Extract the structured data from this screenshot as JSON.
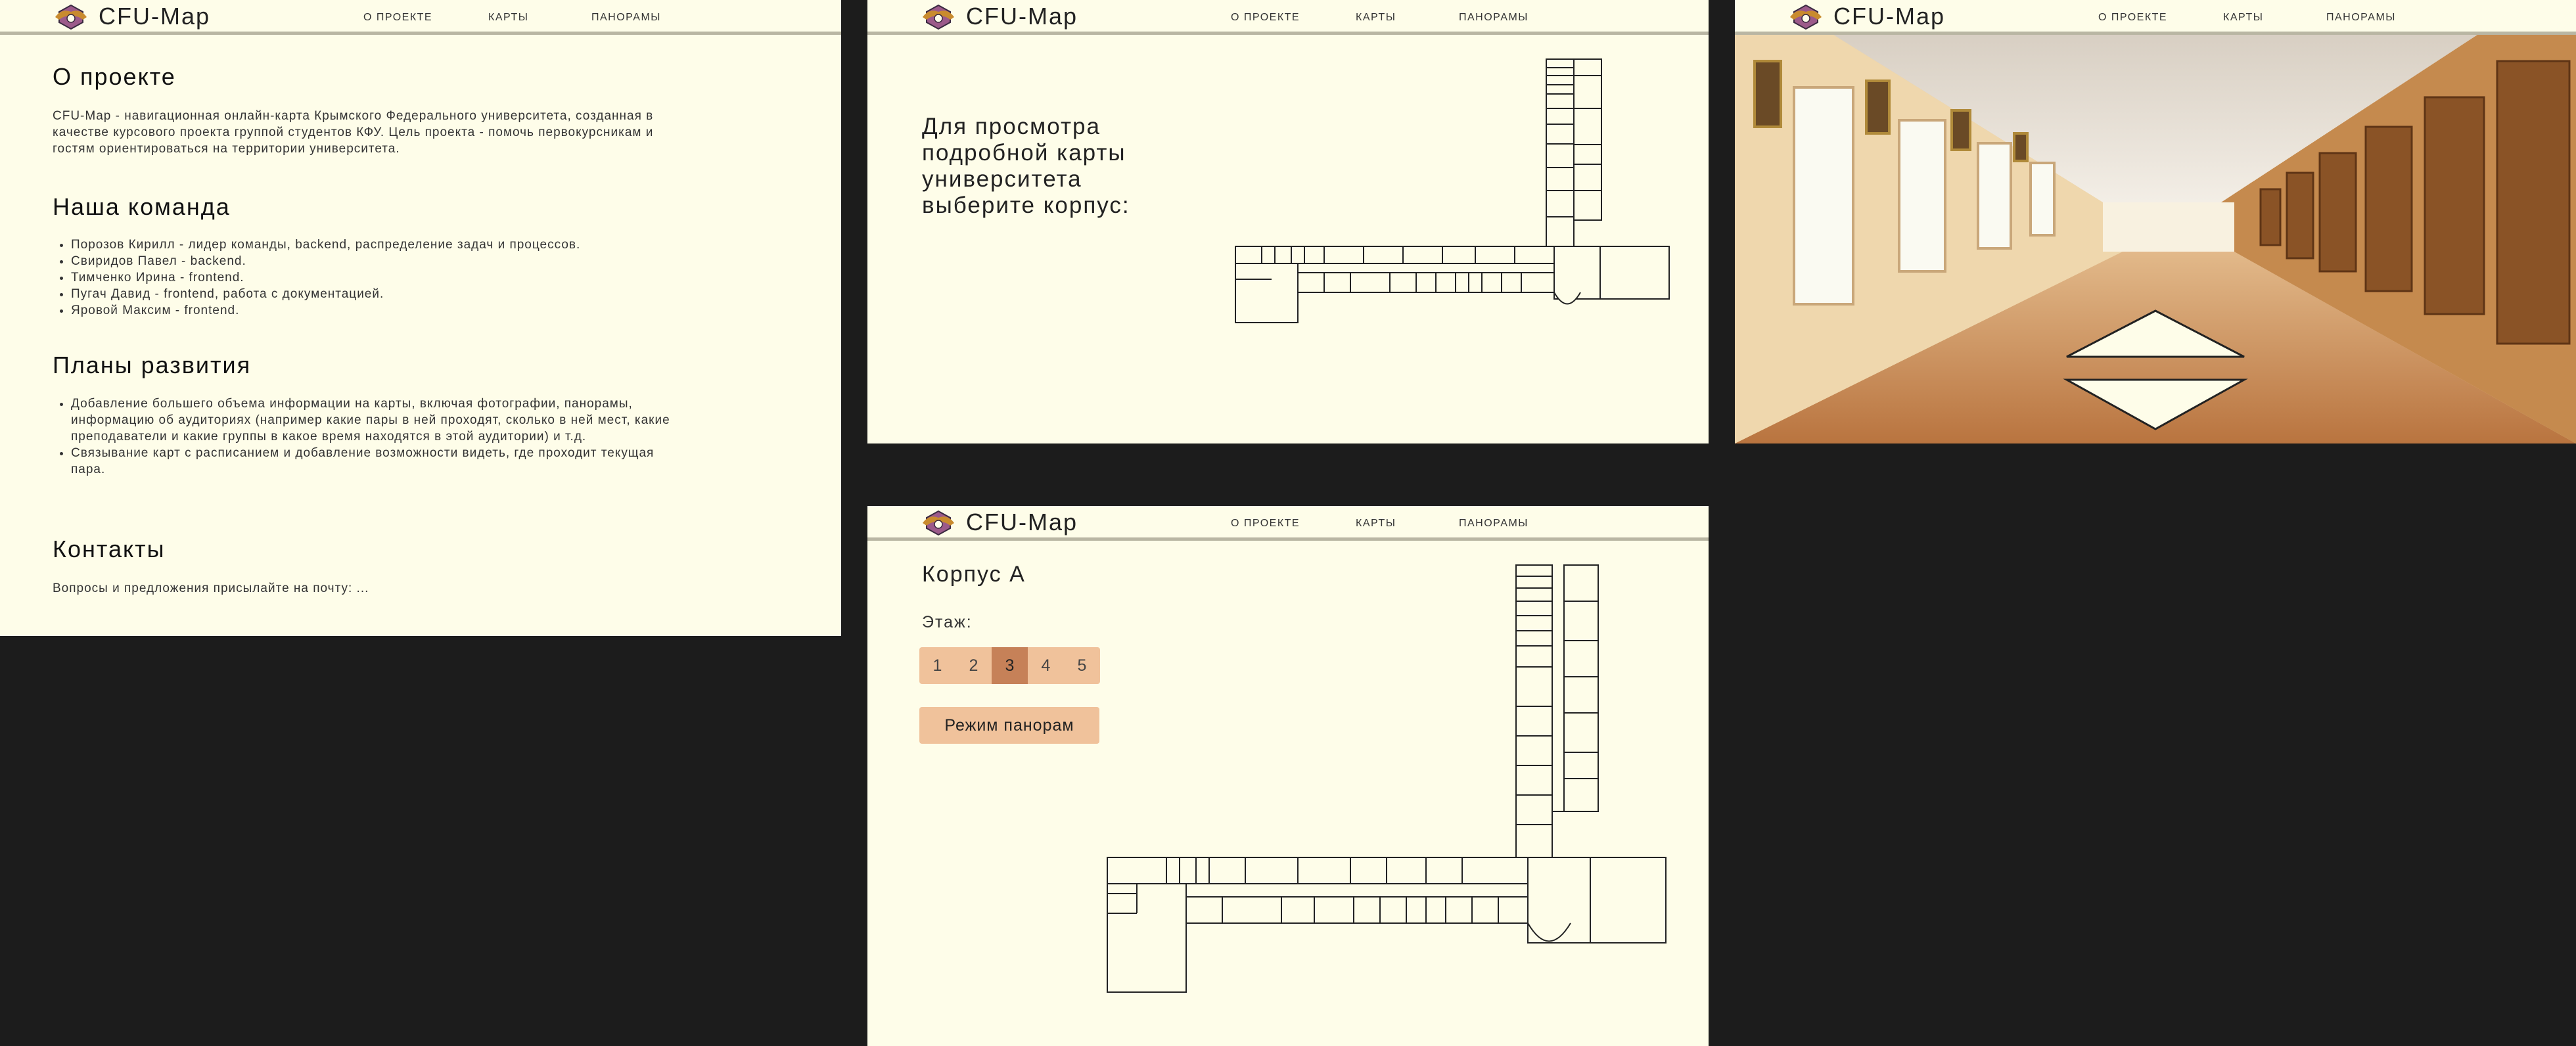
{
  "brand": "CFU-Map",
  "nav": {
    "about": "О ПРОЕКТЕ",
    "maps": "КАРТЫ",
    "panoramas": "ПАНОРАМЫ"
  },
  "about": {
    "title": "О проекте",
    "text": "CFU-Map - навигационная онлайн-карта Крымского Федерального университета, созданная в качестве курсового проекта группой студентов КФУ. Цель проекта - помочь первокурсникам и гостям ориентироваться на территории университета.",
    "team_title": "Наша команда",
    "team": [
      "Порозов Кирилл - лидер команды, backend, распределение задач и процессов.",
      "Свиридов Павел - backend.",
      "Тимченко Ирина - frontend.",
      "Пугач Давид - frontend, работа с документацией.",
      "Яровой Максим - frontend."
    ],
    "plans_title": "Планы развития",
    "plans": [
      "Добавление большего объема информации на карты, включая фотографии, панорамы, информацию об аудиториях (например какие пары в ней проходят, сколько в ней мест, какие преподаватели и какие группы в какое время находятся в этой аудитории) и т.д.",
      "Связывание карт с расписанием и добавление возможности видеть, где проходит текущая пара."
    ],
    "contacts_title": "Контакты",
    "contacts_text": "Вопросы и предложения присылайте на почту: ..."
  },
  "maps": {
    "prompt": "Для просмотра подробной карты университета выберите корпус:"
  },
  "korpus": {
    "title": "Корпус А",
    "floor_label": "Этаж:",
    "floors": [
      "1",
      "2",
      "3",
      "4",
      "5"
    ],
    "active_floor": "3",
    "panorama_button": "Режим панорам"
  },
  "colors": {
    "background": "#fefde9",
    "button": "#f0c29b",
    "button_active": "#c68158",
    "dark": "#1c1c1c"
  }
}
